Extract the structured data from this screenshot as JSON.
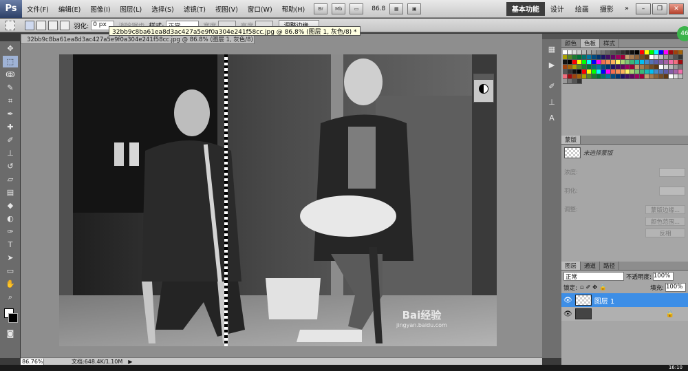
{
  "app": {
    "logo": "Ps"
  },
  "menu": [
    "文件(F)",
    "编辑(E)",
    "图像(I)",
    "图层(L)",
    "选择(S)",
    "滤镜(T)",
    "视图(V)",
    "窗口(W)",
    "帮助(H)"
  ],
  "toolbar_right": {
    "br": "Br",
    "mb": "Mb",
    "zoom": "86.8"
  },
  "workspaces": {
    "active": "基本功能",
    "items": [
      "设计",
      "绘画",
      "摄影"
    ]
  },
  "options": {
    "feather_label": "羽化:",
    "feather_value": "0 px",
    "smooth_label": "消除锯齿",
    "style_label": "样式:",
    "style_value": "正常",
    "width_label": "宽度",
    "height_label": "高度",
    "refine_button": "调整边缘..."
  },
  "document": {
    "tab_title": "32bb9c8ba61ea8d3ac427a5e9f0a304e241f58cc.jpg @ 86.8% (图层 1, 灰色/8) *",
    "tooltip": "32bb9c8ba61ea8d3ac427a5e9f0a304e241f58cc.jpg @ 86.8% (图层 1, 灰色/8) *",
    "zoom": "86.76%",
    "doc_size": "文档:648.4K/1.10M"
  },
  "panels": {
    "swatches_tabs": [
      "颜色",
      "色板",
      "样式"
    ],
    "mask_tab": "蒙版",
    "mask_title": "未选择蒙版",
    "density_label": "浓度:",
    "feather_label": "羽化:",
    "edges_label": "调整:",
    "mask_edge_btn": "蒙版边缘...",
    "color_range_btn": "颜色范围...",
    "invert_btn": "反相",
    "layers_tabs": [
      "图层",
      "通道",
      "路径"
    ],
    "blend_mode": "正常",
    "opacity_label": "不透明度:",
    "opacity_value": "100%",
    "lock_label": "锁定:",
    "fill_label": "填充:",
    "fill_value": "100%",
    "layer1_name": "图层 1"
  },
  "watermark": {
    "brand": "Bai经验",
    "url": "jingyan.baidu.com"
  },
  "clock": "16:10",
  "badge": "46"
}
